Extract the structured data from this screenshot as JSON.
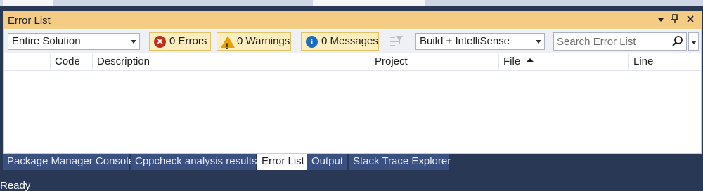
{
  "window": {
    "title": "Error List",
    "controls": [
      "dropdown-arrow",
      "pin",
      "close"
    ]
  },
  "toolbar": {
    "scope_value": "Entire Solution",
    "errors_label": "0 Errors",
    "warnings_label": "0 Warnings",
    "messages_label": "0 Messages",
    "build_filter_value": "Build + IntelliSense",
    "search_placeholder": "Search Error List"
  },
  "table": {
    "columns": [
      "Code",
      "Description",
      "Project",
      "File",
      "Line"
    ],
    "sort_column": "File",
    "sort_direction": "ascending",
    "rows": []
  },
  "tabs": [
    {
      "label": "Package Manager Console",
      "active": false
    },
    {
      "label": "Cppcheck analysis results",
      "active": false
    },
    {
      "label": "Error List",
      "active": true
    },
    {
      "label": "Output",
      "active": false
    },
    {
      "label": "Stack Trace Explorer",
      "active": false
    }
  ],
  "status": {
    "text": "Ready"
  },
  "colors": {
    "title_bar": "#f5cc84",
    "filter_button_bg": "#fdeec0",
    "error": "#c42b1c",
    "warning": "#e5a100",
    "info": "#1a6ec1",
    "status_bar": "#293955"
  }
}
